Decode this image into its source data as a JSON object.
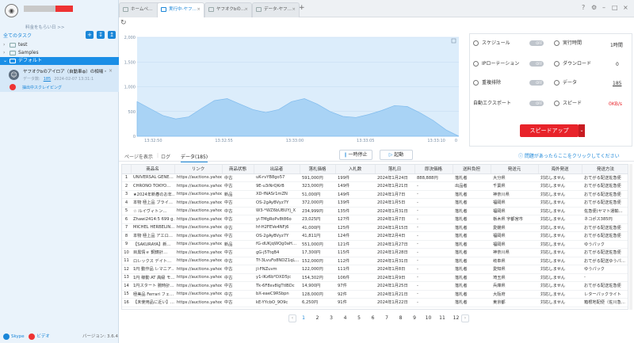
{
  "sidebar": {
    "upgrade_label": "料金をもらい日 >>",
    "all_tasks_label": "全てのタスク",
    "tree": [
      {
        "label": "test",
        "expanded": false
      },
      {
        "label": "Samples",
        "expanded": false
      },
      {
        "label": "デフォルト",
        "expanded": true
      }
    ],
    "task": {
      "title": "ヤフオクbのアイロア（自動車ф）の相場・…",
      "data_label": "データ数:",
      "data_count": "185",
      "date": "2024-02-07 13:31:1",
      "status": "抽出中スクレイピング"
    },
    "footer": {
      "skype": "Skype",
      "youtube": "ビデオ",
      "version": "バージョン: 3.6.4"
    }
  },
  "tabs": [
    {
      "label": "ホームペ…",
      "active": false
    },
    {
      "label": "実行中-ヤフ…",
      "active": true
    },
    {
      "label": "ヤフオクbの…",
      "active": false
    },
    {
      "label": "データ-ヤフ…",
      "active": false
    }
  ],
  "chart_data": {
    "type": "area",
    "x": [
      "13:32:50",
      "13:32:55",
      "13:33:00",
      "13:33:05",
      "13:33:10"
    ],
    "y_ticks": [
      "2,000",
      "1,500",
      "1,000",
      "500",
      "0"
    ],
    "ylim": [
      0,
      2000
    ],
    "values": [
      700,
      560,
      420,
      350,
      390,
      560,
      720,
      760,
      650,
      540,
      480,
      540,
      700,
      760,
      650,
      500,
      400,
      380,
      440,
      520,
      620,
      600,
      470,
      320,
      130,
      0
    ],
    "color": "#a9d3f5"
  },
  "stats": {
    "schedule": {
      "label": "スケジュール",
      "toggle": "OFF"
    },
    "ip_rotation": {
      "label": "IPローテーション",
      "toggle": "OFF"
    },
    "dedup": {
      "label": "重複排除",
      "toggle": "OFF"
    },
    "auto_export": {
      "label": "自動エクスポート",
      "toggle": "OFF"
    },
    "runtime": {
      "label": "実行時間",
      "value": "1時間"
    },
    "download": {
      "label": "ダウンロード",
      "value": "0"
    },
    "data": {
      "label": "データ",
      "value": "185"
    },
    "speed": {
      "label": "スピード",
      "value": "0KB/s"
    },
    "speed_up_button": "スピードアップ"
  },
  "toolbar": {
    "show_page": "ページを表示",
    "log": "ログ",
    "data_tab": "データ(185)",
    "pause": "一時停止",
    "start": "起動",
    "help": "問題があったらここをクリックしてください"
  },
  "table": {
    "headers": [
      "",
      "商品名",
      "リンク",
      "商品状態",
      "出品者",
      "落札価格",
      "入札数",
      "落札日",
      "即決価格",
      "送料負担",
      "発送元",
      "海外発送",
      "発送方法"
    ],
    "rows": [
      [
        "1",
        "UNIVERSAL GENE…",
        "https://auctions.yahoo…",
        "中古",
        "uK-rvYB8go57",
        "591,000円",
        "199件",
        "2024年1月24日",
        "888,888円",
        "落札者",
        "大分県",
        "対応しません",
        "おてがる配送佐急便"
      ],
      [
        "2",
        "CHRONO TOKYO…",
        "https://auctions.yahoo…",
        "中古",
        "9E-u3iNrQKrB",
        "323,000円",
        "149件",
        "2024年1月21日",
        "-",
        "出品者",
        "千葉県",
        "対応しません",
        "おてがる配送佐急便"
      ],
      [
        "3",
        "★2024年新春のお年…",
        "https://auctions.yahoo…",
        "新品",
        "XD-fNASr1mZN",
        "51,000円",
        "149件",
        "2024年1月7日",
        "-",
        "落札者",
        "神奈川県",
        "対応しません",
        "おてがる配送佐急便"
      ],
      [
        "4",
        "本物 極上品 ブライ…",
        "https://auctions.yahoo…",
        "中古",
        "OS-2gAyBVyz7Y",
        "372,000円",
        "139件",
        "2024年1月5日",
        "-",
        "落札者",
        "福岡県",
        "対応しません",
        "おてがる配送佐急便"
      ],
      [
        "5",
        "☆ ルイヴィトン…",
        "https://auctions.yahoo…",
        "中古",
        "W3-*WZ6bUBUYj_X",
        "234,999円",
        "135件",
        "2024年1月31日",
        "-",
        "落札者",
        "福岡県",
        "対応しません",
        "佐急便(ヤマト運輸…"
      ],
      [
        "6",
        "Zhawi2414:5 699 g…",
        "https://auctions.yahoo…",
        "中古",
        "yi-TMgRoPv8t86o",
        "23,025円",
        "127件",
        "2024年1月7日",
        "-",
        "落札者",
        "栃木県 宇都宮市",
        "対応しません",
        "ネコポス385円"
      ],
      [
        "7",
        "MICHEL HERBELIN…",
        "https://auctions.yahoo…",
        "中古",
        "hf-H2FEVe4NFj6",
        "41,000円",
        "125件",
        "2024年1月15日",
        "-",
        "落札者",
        "愛媛県",
        "対応しません",
        "おてがる配送佐急便"
      ],
      [
        "8",
        "本物 極上品 アエロ…",
        "https://auctions.yahoo…",
        "中古",
        "OS-2gAyBVyz7Y",
        "41,811円",
        "124件",
        "2024年2月4日",
        "-",
        "落札者",
        "福岡県",
        "対応しません",
        "おてがる配送佐急便"
      ],
      [
        "9",
        "【SAKURAYA】新…",
        "https://auctions.yahoo…",
        "新品",
        "fG-dUKjqWQg0aH…",
        "551,000円",
        "121件",
        "2024年1月27日",
        "-",
        "落札者",
        "福岡県",
        "対応しません",
        "ゆうパック"
      ],
      [
        "10",
        "目黒情ｅ 鋼鋳計…",
        "https://auctions.yahoo…",
        "中古",
        "gG-j5TtqB4",
        "17,300円",
        "115件",
        "2024年1月28日",
        "-",
        "落札者",
        "神奈川県",
        "対応しません",
        "おてがる配送佐急便"
      ],
      [
        "11",
        "ロレックス デイト…",
        "https://auctions.yahoo…",
        "中古",
        "Tf-3LvuFo8NDZ1qL…",
        "152,000円",
        "112件",
        "2024年1月31日",
        "-",
        "落札者",
        "岐阜県",
        "対応しません",
        "おてがる配送ゆうパ…"
      ],
      [
        "12",
        "1円 動作品 レマニア…",
        "https://auctions.yahoo…",
        "中古",
        "jl-FNZuvm",
        "122,000円",
        "111件",
        "2024年1月8日",
        "-",
        "落札者",
        "愛知県",
        "対応しません",
        "ゆうパック"
      ],
      [
        "13",
        "1円 稼動 AT 高級 モ…",
        "https://auctions.yahoo…",
        "中古",
        "y1-lKz6b*DXD5jc",
        "154,302円",
        "106件",
        "2024年1月9日",
        "-",
        "落札者",
        "埼玉県",
        "対応しません",
        "-"
      ],
      [
        "14",
        "1円スタート 腕時計…",
        "https://auctions.yahoo…",
        "中古",
        "Tk-6F8sv8lgTtIBDc",
        "14,900円",
        "97件",
        "2024年1月25日",
        "-",
        "落札者",
        "兵庫県",
        "対応しません",
        "おてがる配送佐急便"
      ],
      [
        "15",
        "極美品 Ferrari フェ…",
        "https://auctions.yahoo…",
        "中古",
        "bX-eaeC9RSbpn",
        "128,000円",
        "92件",
        "2024年1月21日",
        "-",
        "落札者",
        "大阪府",
        "対応しません",
        "レターパックライト"
      ],
      [
        "16",
        "【未使用品に近い】…",
        "https://auctions.yahoo…",
        "中古",
        "kE-YYcbO_9O9c",
        "6,250円",
        "91件",
        "2024年1月22日",
        "-",
        "落札者",
        "東京都",
        "対応しません",
        "箱根地配便（佐川急…"
      ]
    ]
  },
  "pagination": {
    "pages": [
      "1",
      "2",
      "3",
      "4",
      "5",
      "6",
      "7",
      "8",
      "9",
      "10",
      "11",
      "12"
    ],
    "current": "1",
    "prev": "‹",
    "next": "›"
  }
}
